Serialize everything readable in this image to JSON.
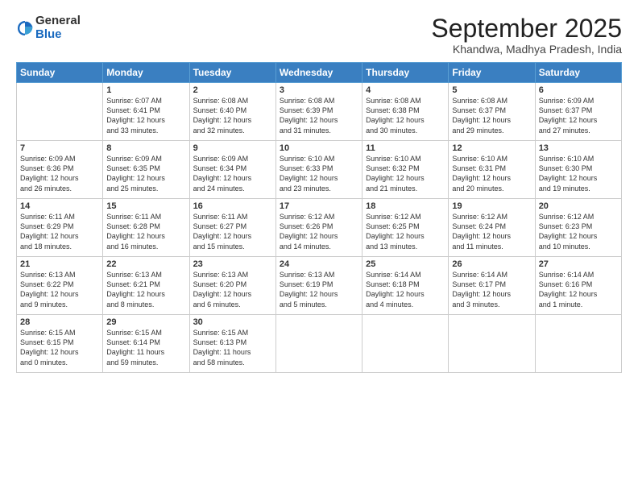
{
  "logo": {
    "general": "General",
    "blue": "Blue"
  },
  "title": "September 2025",
  "subtitle": "Khandwa, Madhya Pradesh, India",
  "days_header": [
    "Sunday",
    "Monday",
    "Tuesday",
    "Wednesday",
    "Thursday",
    "Friday",
    "Saturday"
  ],
  "weeks": [
    [
      {
        "day": "",
        "info": ""
      },
      {
        "day": "1",
        "info": "Sunrise: 6:07 AM\nSunset: 6:41 PM\nDaylight: 12 hours\nand 33 minutes."
      },
      {
        "day": "2",
        "info": "Sunrise: 6:08 AM\nSunset: 6:40 PM\nDaylight: 12 hours\nand 32 minutes."
      },
      {
        "day": "3",
        "info": "Sunrise: 6:08 AM\nSunset: 6:39 PM\nDaylight: 12 hours\nand 31 minutes."
      },
      {
        "day": "4",
        "info": "Sunrise: 6:08 AM\nSunset: 6:38 PM\nDaylight: 12 hours\nand 30 minutes."
      },
      {
        "day": "5",
        "info": "Sunrise: 6:08 AM\nSunset: 6:37 PM\nDaylight: 12 hours\nand 29 minutes."
      },
      {
        "day": "6",
        "info": "Sunrise: 6:09 AM\nSunset: 6:37 PM\nDaylight: 12 hours\nand 27 minutes."
      }
    ],
    [
      {
        "day": "7",
        "info": "Sunrise: 6:09 AM\nSunset: 6:36 PM\nDaylight: 12 hours\nand 26 minutes."
      },
      {
        "day": "8",
        "info": "Sunrise: 6:09 AM\nSunset: 6:35 PM\nDaylight: 12 hours\nand 25 minutes."
      },
      {
        "day": "9",
        "info": "Sunrise: 6:09 AM\nSunset: 6:34 PM\nDaylight: 12 hours\nand 24 minutes."
      },
      {
        "day": "10",
        "info": "Sunrise: 6:10 AM\nSunset: 6:33 PM\nDaylight: 12 hours\nand 23 minutes."
      },
      {
        "day": "11",
        "info": "Sunrise: 6:10 AM\nSunset: 6:32 PM\nDaylight: 12 hours\nand 21 minutes."
      },
      {
        "day": "12",
        "info": "Sunrise: 6:10 AM\nSunset: 6:31 PM\nDaylight: 12 hours\nand 20 minutes."
      },
      {
        "day": "13",
        "info": "Sunrise: 6:10 AM\nSunset: 6:30 PM\nDaylight: 12 hours\nand 19 minutes."
      }
    ],
    [
      {
        "day": "14",
        "info": "Sunrise: 6:11 AM\nSunset: 6:29 PM\nDaylight: 12 hours\nand 18 minutes."
      },
      {
        "day": "15",
        "info": "Sunrise: 6:11 AM\nSunset: 6:28 PM\nDaylight: 12 hours\nand 16 minutes."
      },
      {
        "day": "16",
        "info": "Sunrise: 6:11 AM\nSunset: 6:27 PM\nDaylight: 12 hours\nand 15 minutes."
      },
      {
        "day": "17",
        "info": "Sunrise: 6:12 AM\nSunset: 6:26 PM\nDaylight: 12 hours\nand 14 minutes."
      },
      {
        "day": "18",
        "info": "Sunrise: 6:12 AM\nSunset: 6:25 PM\nDaylight: 12 hours\nand 13 minutes."
      },
      {
        "day": "19",
        "info": "Sunrise: 6:12 AM\nSunset: 6:24 PM\nDaylight: 12 hours\nand 11 minutes."
      },
      {
        "day": "20",
        "info": "Sunrise: 6:12 AM\nSunset: 6:23 PM\nDaylight: 12 hours\nand 10 minutes."
      }
    ],
    [
      {
        "day": "21",
        "info": "Sunrise: 6:13 AM\nSunset: 6:22 PM\nDaylight: 12 hours\nand 9 minutes."
      },
      {
        "day": "22",
        "info": "Sunrise: 6:13 AM\nSunset: 6:21 PM\nDaylight: 12 hours\nand 8 minutes."
      },
      {
        "day": "23",
        "info": "Sunrise: 6:13 AM\nSunset: 6:20 PM\nDaylight: 12 hours\nand 6 minutes."
      },
      {
        "day": "24",
        "info": "Sunrise: 6:13 AM\nSunset: 6:19 PM\nDaylight: 12 hours\nand 5 minutes."
      },
      {
        "day": "25",
        "info": "Sunrise: 6:14 AM\nSunset: 6:18 PM\nDaylight: 12 hours\nand 4 minutes."
      },
      {
        "day": "26",
        "info": "Sunrise: 6:14 AM\nSunset: 6:17 PM\nDaylight: 12 hours\nand 3 minutes."
      },
      {
        "day": "27",
        "info": "Sunrise: 6:14 AM\nSunset: 6:16 PM\nDaylight: 12 hours\nand 1 minute."
      }
    ],
    [
      {
        "day": "28",
        "info": "Sunrise: 6:15 AM\nSunset: 6:15 PM\nDaylight: 12 hours\nand 0 minutes."
      },
      {
        "day": "29",
        "info": "Sunrise: 6:15 AM\nSunset: 6:14 PM\nDaylight: 11 hours\nand 59 minutes."
      },
      {
        "day": "30",
        "info": "Sunrise: 6:15 AM\nSunset: 6:13 PM\nDaylight: 11 hours\nand 58 minutes."
      },
      {
        "day": "",
        "info": ""
      },
      {
        "day": "",
        "info": ""
      },
      {
        "day": "",
        "info": ""
      },
      {
        "day": "",
        "info": ""
      }
    ]
  ]
}
